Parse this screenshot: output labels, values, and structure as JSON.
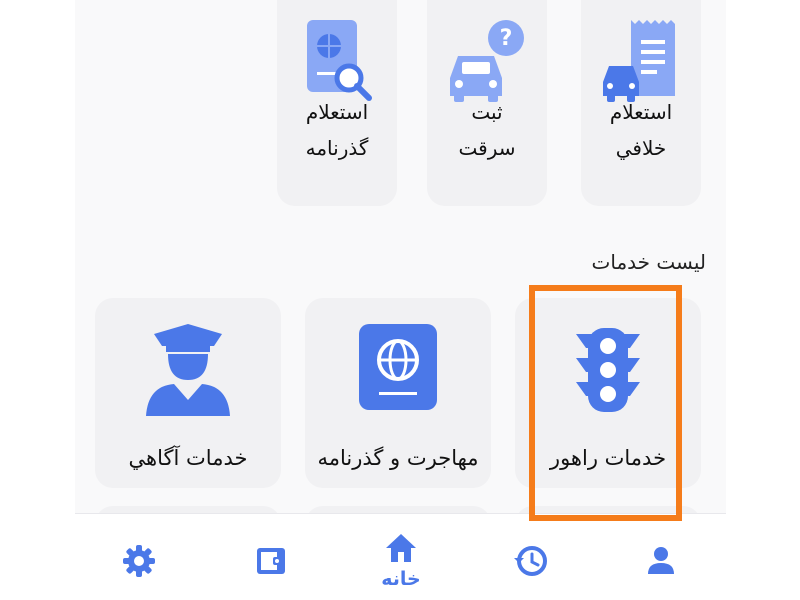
{
  "colors": {
    "accent": "#4b78e8",
    "icon_light": "#8aa8f5",
    "highlight": "#f57c1a"
  },
  "top_services": [
    {
      "line1": "استعلام",
      "line2": "خلافي",
      "icon": "traffic-fine-receipt-icon"
    },
    {
      "line1": "ثبت",
      "line2": "سرقت",
      "icon": "car-question-icon"
    },
    {
      "line1": "استعلام",
      "line2": "گذرنامه",
      "icon": "passport-search-icon"
    }
  ],
  "section_title": "لیست خدمات",
  "services": [
    {
      "label": "خدمات راهور",
      "icon": "traffic-light-icon"
    },
    {
      "label": "مهاجرت و گذرنامه",
      "icon": "passport-globe-icon"
    },
    {
      "label": "خدمات آگاهي",
      "icon": "police-officer-icon"
    }
  ],
  "nav": {
    "home_label": "خانه",
    "items": [
      "profile-icon",
      "history-icon",
      "home-icon",
      "wallet-icon",
      "settings-icon"
    ]
  }
}
